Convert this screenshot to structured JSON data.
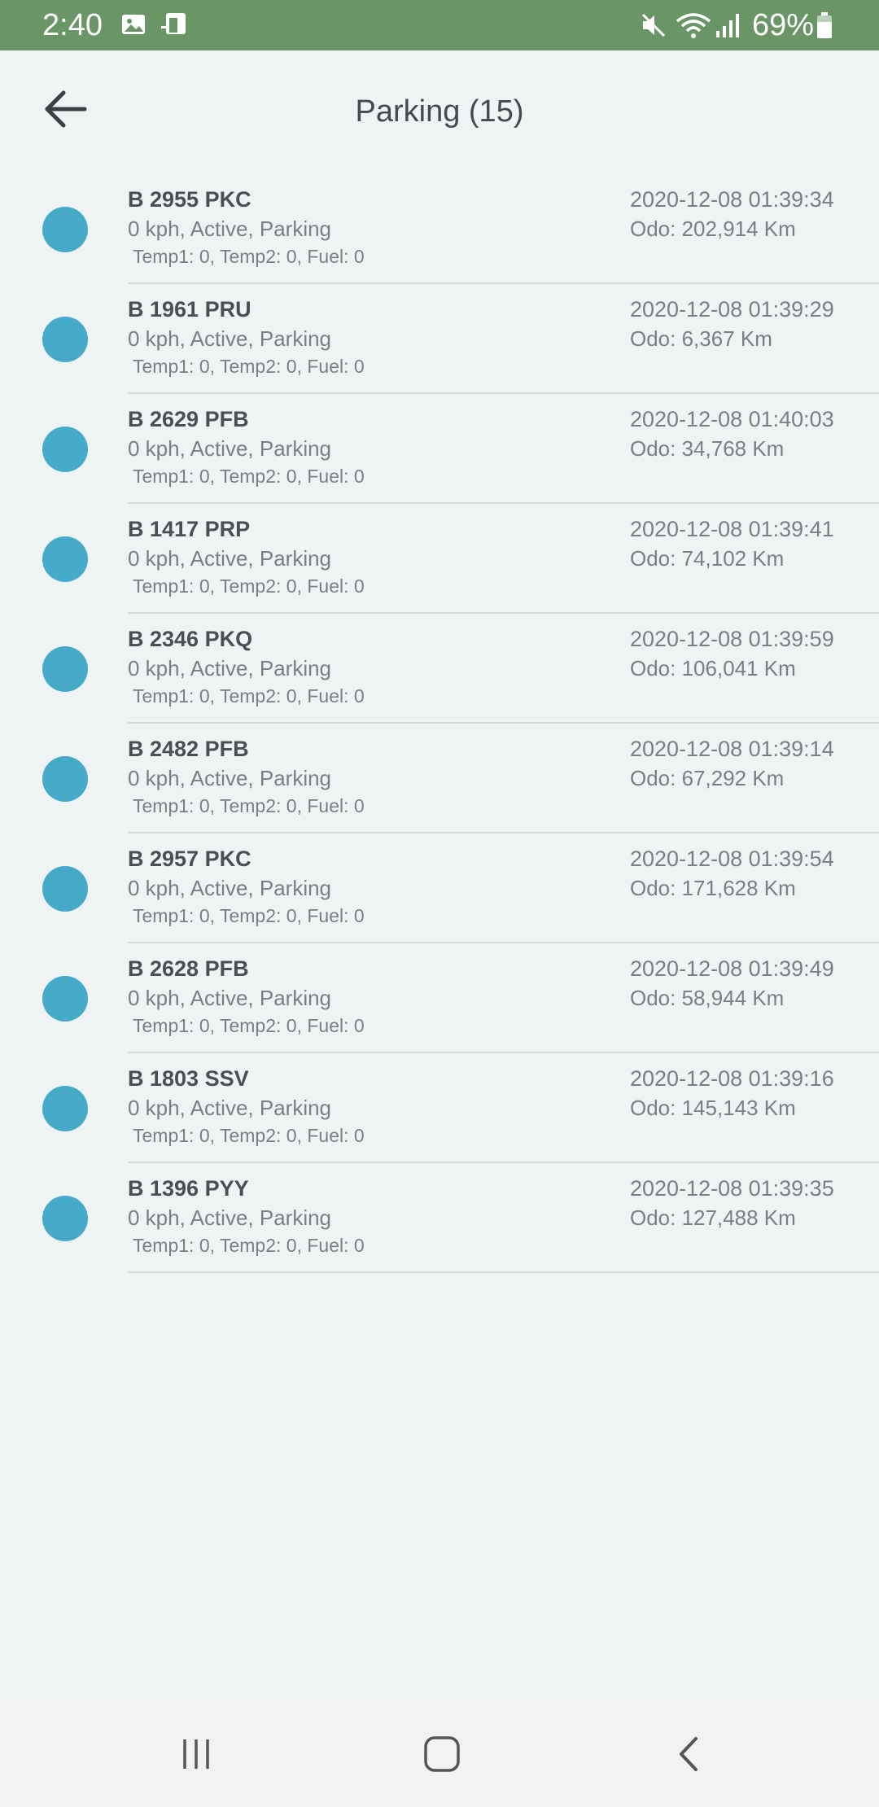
{
  "status_bar": {
    "time": "2:40",
    "icons": [
      "image-icon",
      "cast-icon",
      "mute-icon",
      "wifi-icon",
      "signal-icon",
      "battery-icon"
    ],
    "battery_percent": "69%",
    "background": "#6a9567"
  },
  "header": {
    "title": "Parking (15)",
    "back_icon": "arrow-left-icon"
  },
  "colors": {
    "status_dot": "#45abc8",
    "background": "#f0f3f4"
  },
  "vehicles": [
    {
      "plate": "B 2955 PKC",
      "status": "0 kph, Active, Parking",
      "sensors": "Temp1: 0, Temp2: 0, Fuel: 0",
      "timestamp": "2020-12-08 01:39:34",
      "odo": "Odo: 202,914 Km"
    },
    {
      "plate": "B 1961 PRU",
      "status": "0 kph, Active, Parking",
      "sensors": "Temp1: 0, Temp2: 0, Fuel: 0",
      "timestamp": "2020-12-08 01:39:29",
      "odo": "Odo: 6,367 Km"
    },
    {
      "plate": "B 2629 PFB",
      "status": "0 kph, Active, Parking",
      "sensors": "Temp1: 0, Temp2: 0, Fuel: 0",
      "timestamp": "2020-12-08 01:40:03",
      "odo": "Odo: 34,768 Km"
    },
    {
      "plate": "B 1417 PRP",
      "status": "0 kph, Active, Parking",
      "sensors": "Temp1: 0, Temp2: 0, Fuel: 0",
      "timestamp": "2020-12-08 01:39:41",
      "odo": "Odo: 74,102 Km"
    },
    {
      "plate": "B 2346 PKQ",
      "status": "0 kph, Active, Parking",
      "sensors": "Temp1: 0, Temp2: 0, Fuel: 0",
      "timestamp": "2020-12-08 01:39:59",
      "odo": "Odo: 106,041 Km"
    },
    {
      "plate": "B 2482 PFB",
      "status": "0 kph, Active, Parking",
      "sensors": "Temp1: 0, Temp2: 0, Fuel: 0",
      "timestamp": "2020-12-08 01:39:14",
      "odo": "Odo: 67,292 Km"
    },
    {
      "plate": "B 2957 PKC",
      "status": "0 kph, Active, Parking",
      "sensors": "Temp1: 0, Temp2: 0, Fuel: 0",
      "timestamp": "2020-12-08 01:39:54",
      "odo": "Odo: 171,628 Km"
    },
    {
      "plate": "B 2628 PFB",
      "status": "0 kph, Active, Parking",
      "sensors": "Temp1: 0, Temp2: 0, Fuel: 0",
      "timestamp": "2020-12-08 01:39:49",
      "odo": "Odo: 58,944 Km"
    },
    {
      "plate": "B 1803 SSV",
      "status": "0 kph, Active, Parking",
      "sensors": "Temp1: 0, Temp2: 0, Fuel: 0",
      "timestamp": "2020-12-08 01:39:16",
      "odo": "Odo: 145,143 Km"
    },
    {
      "plate": "B 1396 PYY",
      "status": "0 kph, Active, Parking",
      "sensors": "Temp1: 0, Temp2: 0, Fuel: 0",
      "timestamp": "2020-12-08 01:39:35",
      "odo": "Odo: 127,488 Km"
    }
  ],
  "nav_bar": {
    "buttons": [
      "recents-icon",
      "home-icon",
      "back-icon"
    ]
  }
}
